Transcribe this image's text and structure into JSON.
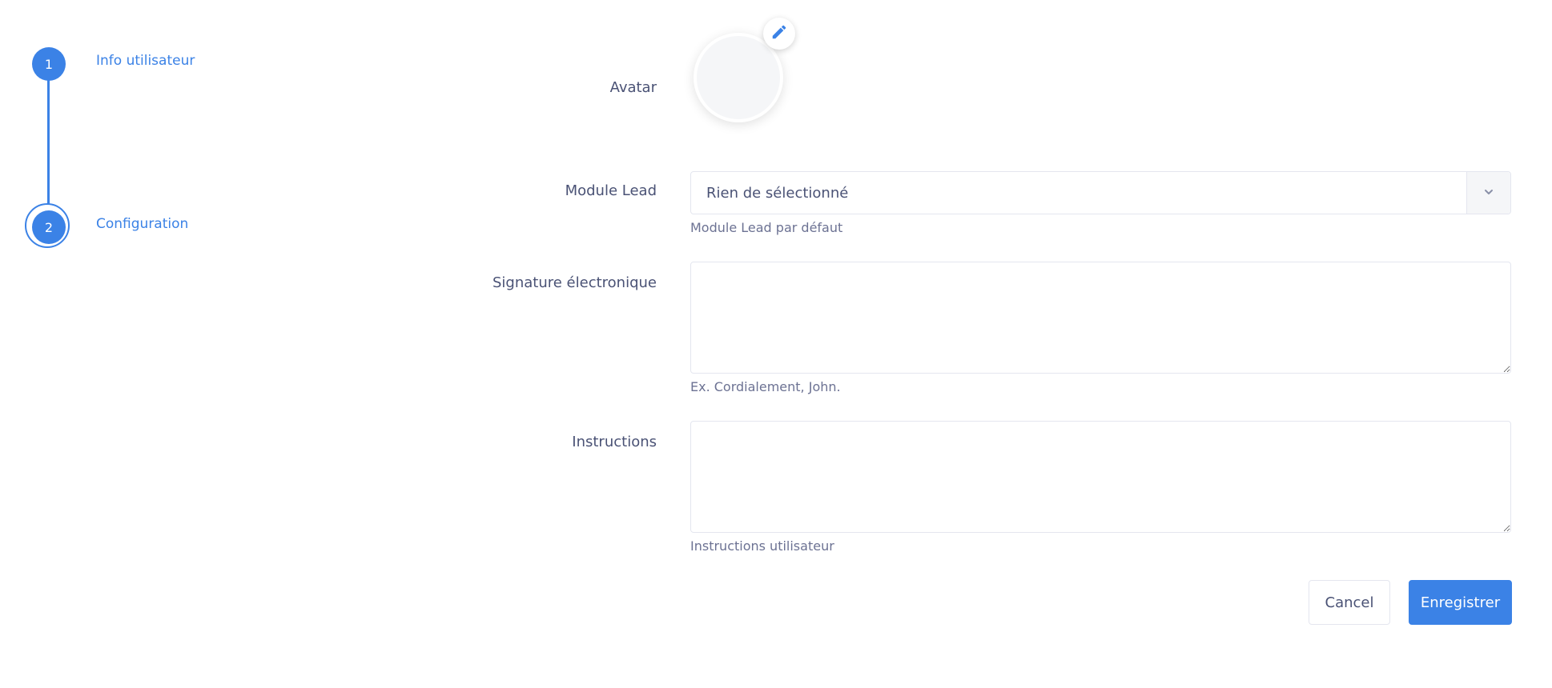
{
  "stepper": {
    "steps": [
      {
        "number": "1",
        "label": "Info utilisateur"
      },
      {
        "number": "2",
        "label": "Configuration"
      }
    ]
  },
  "form": {
    "avatar": {
      "label": "Avatar",
      "edit_icon": "pencil-icon"
    },
    "module_lead": {
      "label": "Module Lead",
      "selected_value": "Rien de sélectionné",
      "help": "Module Lead par défaut",
      "toggle_icon": "chevron-down-icon"
    },
    "signature": {
      "label": "Signature électronique",
      "value": "",
      "help": "Ex. Cordialement, John."
    },
    "instructions": {
      "label": "Instructions",
      "value": "",
      "help": "Instructions utilisateur"
    }
  },
  "actions": {
    "cancel_label": "Cancel",
    "save_label": "Enregistrer"
  },
  "colors": {
    "accent": "#3b82e6",
    "label": "#4a5275",
    "help": "#6c7293",
    "border": "#e4e6ef"
  }
}
